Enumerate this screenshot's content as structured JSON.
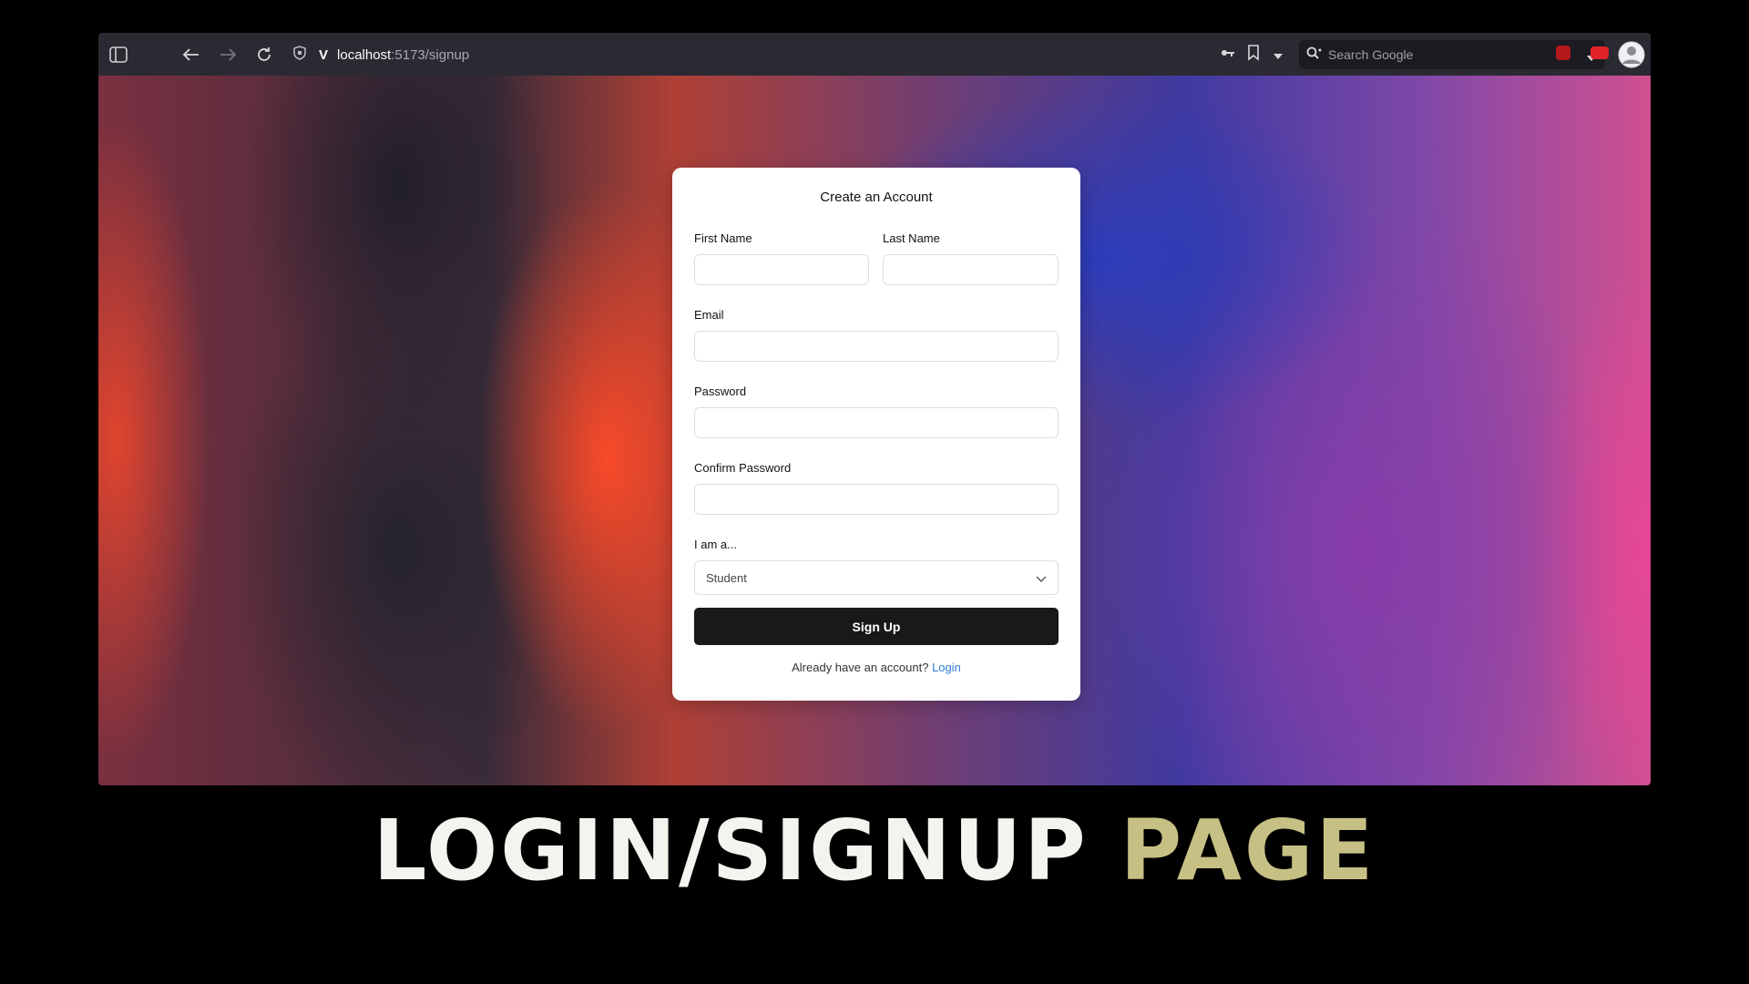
{
  "browser": {
    "url_host": "localhost",
    "url_path": ":5173/signup",
    "search_placeholder": "Search Google"
  },
  "form": {
    "title": "Create an Account",
    "first_name_label": "First Name",
    "last_name_label": "Last Name",
    "email_label": "Email",
    "password_label": "Password",
    "confirm_password_label": "Confirm Password",
    "role_label": "I am a...",
    "role_value": "Student",
    "submit_label": "Sign Up",
    "footer_text": "Already have an account?",
    "login_link": "Login"
  },
  "caption": {
    "main": "LOGIN/SIGNUP",
    "accent": "PAGE"
  },
  "colors": {
    "caption_accent": "#c7c085",
    "link": "#2f7bd6",
    "button": "#1a1818"
  }
}
